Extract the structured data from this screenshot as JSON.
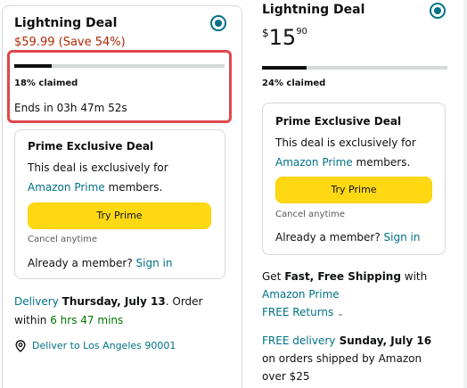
{
  "left_deal": {
    "title": "Lightning Deal",
    "price": "$59.99 (Save 54%)",
    "claimed_fraction": 0.18,
    "claimed_text": "18% claimed",
    "ends_text": "Ends in 03h 47m 52s",
    "prime": {
      "title": "Prime Exclusive Deal",
      "line1": "This deal is exclusively for",
      "link": "Amazon Prime",
      "line2_rest": " members.",
      "button": "Try Prime",
      "cancel": "Cancel anytime",
      "member_text": "Already a member?",
      "sign_in": "Sign in"
    },
    "delivery": {
      "label": "Delivery",
      "date": "Thursday, July 13",
      "order_text": ". Order",
      "within": "within",
      "time_left": "6 hrs 47 mins"
    },
    "deliver_to": "Deliver to Los Angeles 90001"
  },
  "right_deal": {
    "title": "Lightning Deal",
    "price_symbol": "$",
    "price_whole": "15",
    "price_fraction": "90",
    "claimed_fraction": 0.24,
    "claimed_text": "24% claimed",
    "prime": {
      "title": "Prime Exclusive Deal",
      "line1": "This deal is exclusively for",
      "link": "Amazon Prime",
      "line2_rest": " members.",
      "button": "Try Prime",
      "cancel": "Cancel anytime",
      "member_text": "Already a member?",
      "sign_in": "Sign in"
    },
    "shipping": {
      "get": "Get ",
      "fast_free": "Fast, Free Shipping",
      "with": " with",
      "amazon_prime": "Amazon Prime",
      "free_returns": "FREE Returns",
      "free_delivery": "FREE delivery",
      "date": " Sunday, July 16",
      "line2": "on orders shipped by Amazon",
      "line3": "over $25"
    }
  },
  "colors": {
    "accent": "#007185",
    "price_red": "#B12704",
    "button": "#FFD814",
    "highlight": "#E0474C",
    "green": "#007600"
  }
}
